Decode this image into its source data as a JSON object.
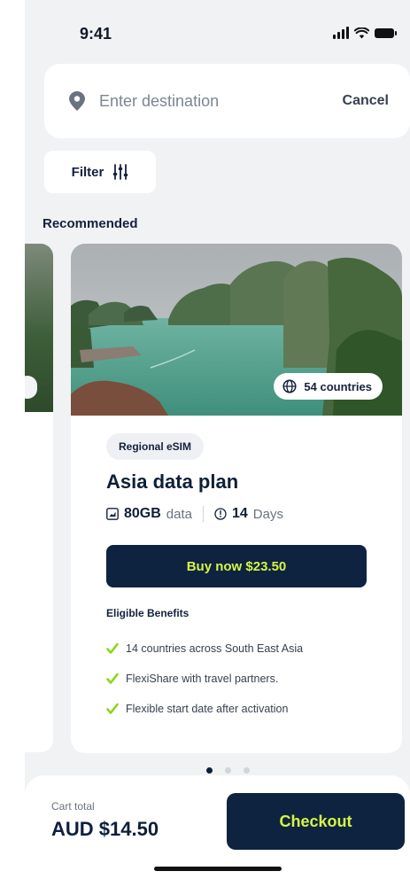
{
  "status_bar": {
    "time": "9:41"
  },
  "search": {
    "placeholder": "Enter destination",
    "cancel_label": "Cancel"
  },
  "filter": {
    "label": "Filter"
  },
  "section": {
    "title": "Recommended"
  },
  "plan_card": {
    "countries_badge": "54 countries",
    "tag": "Regional eSIM",
    "title": "Asia data plan",
    "data_amount": "80GB",
    "data_unit": "data",
    "days_amount": "14",
    "days_unit": "Days",
    "buy_label": "Buy now $23.50",
    "benefits_title": "Eligible Benefits",
    "benefits": [
      "14 countries across South East Asia",
      "FlexiShare with travel partners.",
      "Flexible start date after activation"
    ]
  },
  "pagination": {
    "total": 3,
    "active": 0
  },
  "cart": {
    "label": "Cart total",
    "value": "AUD $14.50",
    "checkout_label": "Checkout"
  },
  "colors": {
    "navy": "#0d2340",
    "accent": "#d7f542",
    "check": "#8dd61e",
    "background": "#f1f2f4"
  }
}
